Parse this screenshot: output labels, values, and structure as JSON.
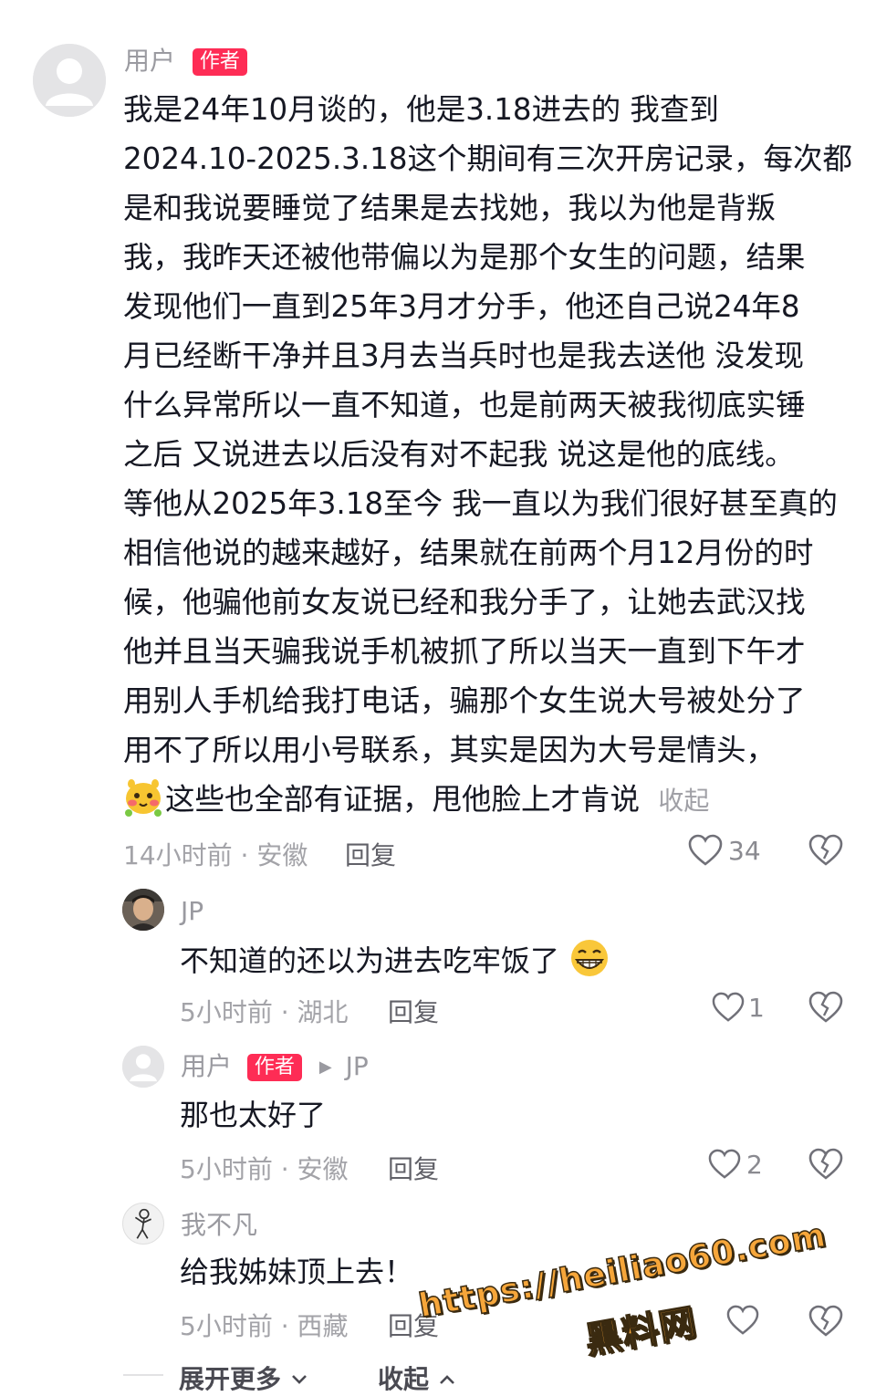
{
  "main_comment": {
    "username": "用户",
    "badge": "作者",
    "text_lines": [
      "我是24年10月谈的，他是3.18进去的 我查到",
      "2024.10-2025.3.18这个期间有三次开房记录，每次都",
      "是和我说要睡觉了结果是去找她，我以为他是背叛",
      "我，我昨天还被他带偏以为是那个女生的问题，结果",
      "发现他们一直到25年3月才分手，他还自己说24年8",
      "月已经断干净并且3月去当兵时也是我去送他 没发现",
      "什么异常所以一直不知道，也是前两天被我彻底实锤",
      "之后 又说进去以后没有对不起我 说这是他的底线。",
      "等他从2025年3.18至今 我一直以为我们很好甚至真的",
      "相信他说的越来越好，结果就在前两个月12月份的时",
      "候，他骗他前女友说已经和我分手了，让她去武汉找",
      "他并且当天骗我说手机被抓了所以当天一直到下午才",
      "用别人手机给我打电话，骗那个女生说大号被处分了",
      "用不了所以用小号联系，其实是因为大号是情头，"
    ],
    "last_line": "这些也全部有证据，甩他脸上才肯说",
    "collapse_label": "收起",
    "meta": "14小时前 · 安徽",
    "reply_label": "回复",
    "likes": "34"
  },
  "replies": [
    {
      "username": "JP",
      "text": "不知道的还以为进去吃牢饭了",
      "emoji": "grin-emoji",
      "meta": "5小时前 · 湖北",
      "reply_label": "回复",
      "likes": "1"
    },
    {
      "username": "用户",
      "badge": "作者",
      "reply_to": "JP",
      "text": "那也太好了",
      "meta": "5小时前 · 安徽",
      "reply_label": "回复",
      "likes": "2"
    },
    {
      "username": "我不凡",
      "text": "给我姊妹顶上去！",
      "meta": "5小时前 · 西藏",
      "reply_label": "回复",
      "likes": ""
    }
  ],
  "footer": {
    "expand_label": "展开更多",
    "collapse_label": "收起"
  },
  "watermark": {
    "url": "https://heiliao60.com",
    "site": "黑料网"
  },
  "colors": {
    "badge": "#fe2c55",
    "text": "#161823",
    "meta": "#a3a3a8",
    "watermark": "#f6a63a"
  }
}
